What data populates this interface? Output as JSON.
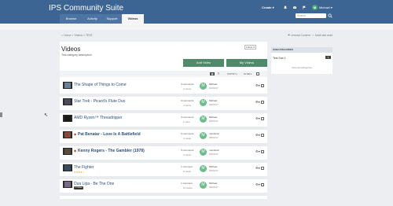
{
  "header": {
    "brand": "IPS Community Suite",
    "create_label": "Create ▾",
    "user_initial": "M",
    "user_name": "Michael ▾",
    "search_placeholder": "Search",
    "tabs": [
      "Browse",
      "Activity",
      "Support",
      "Videos"
    ],
    "active_tab": "Videos",
    "colors": {
      "header_bg": "#3d6594",
      "button_green": "#4f8a6a",
      "link": "#2b4f7c"
    }
  },
  "breadcrumb": {
    "text": "⌂ Home  >  Videos  >  TEST",
    "unread": "⚑ Unread Content",
    "mark_read": "✓ Mark site read"
  },
  "main": {
    "title": "Videos",
    "description": "Test category description",
    "follow_label": "Follow ▾",
    "add_video": "Add Video",
    "my_videos": "My Videos",
    "sort_label": "SORT BY ▾",
    "filter_label": "FILTER ▾"
  },
  "rows": [
    {
      "title": "The Shape of Things to Come",
      "comments": "0 comments",
      "views": "2 views",
      "author": "Michael",
      "date": "04/04/17",
      "avatar": "M",
      "pinned": false
    },
    {
      "title": "Star Trek - Picard's Flute Duo",
      "comments": "0 comments",
      "views": "3 views",
      "author": "Michael",
      "date": "04/04/17",
      "avatar": "M",
      "pinned": false
    },
    {
      "title": "AMD Ryzen™ Threadripper",
      "comments": "0 comments",
      "views": "1 view",
      "author": "Michael",
      "date": "04/04/17",
      "avatar": "M",
      "pinned": false
    },
    {
      "title": "Pat Benatar - Love Is A Battlefield",
      "comments": "0 comments",
      "views": "4 views",
      "author": "member2",
      "date": "04/04/17",
      "avatar": "M",
      "pinned": true
    },
    {
      "title": "Kenny Rogers - The Gambler (1978)",
      "comments": "0 comments",
      "views": "4 views",
      "author": "member2",
      "date": "04/04/17",
      "avatar": "M",
      "pinned": true
    },
    {
      "title": "The Fighter",
      "comments": "1 comment",
      "views": "9 views",
      "author": "Michael",
      "date": "04/04/17",
      "avatar": "M",
      "pinned": false,
      "stars": "★★★★☆"
    },
    {
      "title": "Dua Lipa - Be The One",
      "comments": "1 comment",
      "views": "10 views",
      "author": "Michael",
      "date": "04/04/17",
      "avatar": "M",
      "pinned": false,
      "badge": "0 Hidden"
    }
  ],
  "sidebar": {
    "heading": "SUBCATEGORIES",
    "item": "Test Sub 1",
    "count": "1",
    "view_all": "View All Categories"
  }
}
